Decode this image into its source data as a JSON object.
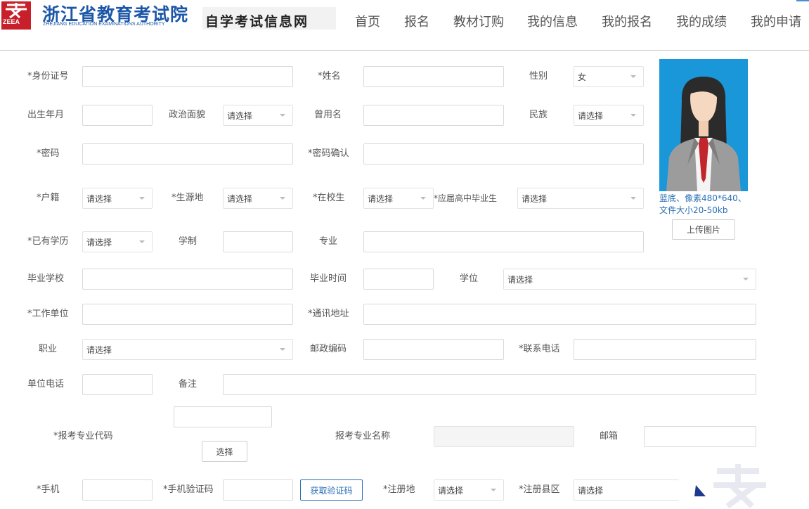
{
  "header": {
    "logo_badge": "ZEEA",
    "org_name": "浙江省教育考试院",
    "org_name_en": "ZHEJIANG EDUCATION EXAMINATIONS AUTHORITY",
    "site_name": "自学考试信息网",
    "nav": [
      "首页",
      "报名",
      "教材订购",
      "我的信息",
      "我的报名",
      "我的成绩",
      "我的申请"
    ]
  },
  "form": {
    "id_card": "*身份证号",
    "name": "*姓名",
    "gender": "性别",
    "gender_value": "女",
    "birth": "出生年月",
    "politics": "政治面貌",
    "former_name": "曾用名",
    "ethnicity": "民族",
    "password": "*密码",
    "password_confirm": "*密码确认",
    "hukou": "*户籍",
    "origin": "*生源地",
    "in_school": "*在校生",
    "fresh_grad": "*应届高中毕业生",
    "education": "*已有学历",
    "schooling": "学制",
    "major": "专业",
    "grad_school": "毕业学校",
    "grad_time": "毕业时间",
    "degree": "学位",
    "work_unit": "*工作单位",
    "address": "*通讯地址",
    "occupation": "职业",
    "postcode": "邮政编码",
    "phone": "*联系电话",
    "unit_phone": "单位电话",
    "remark": "备注",
    "major_code": "*报考专业代码",
    "major_name": "报考专业名称",
    "email": "邮箱",
    "mobile": "*手机",
    "sms_code": "*手机验证码",
    "reg_place": "*注册地",
    "reg_county": "*注册县区",
    "placeholder_select": "请选择"
  },
  "buttons": {
    "choose": "选择",
    "get_code": "获取验证码",
    "upload": "上传图片"
  },
  "photo": {
    "hint": "蓝底、像素480*640、文件大小20-50kb"
  },
  "colors": {
    "photo_bg": "#1a97d9",
    "link_blue": "#2a6fb5",
    "logo_red": "#d6242a",
    "logo_blue": "#1d57a8"
  }
}
